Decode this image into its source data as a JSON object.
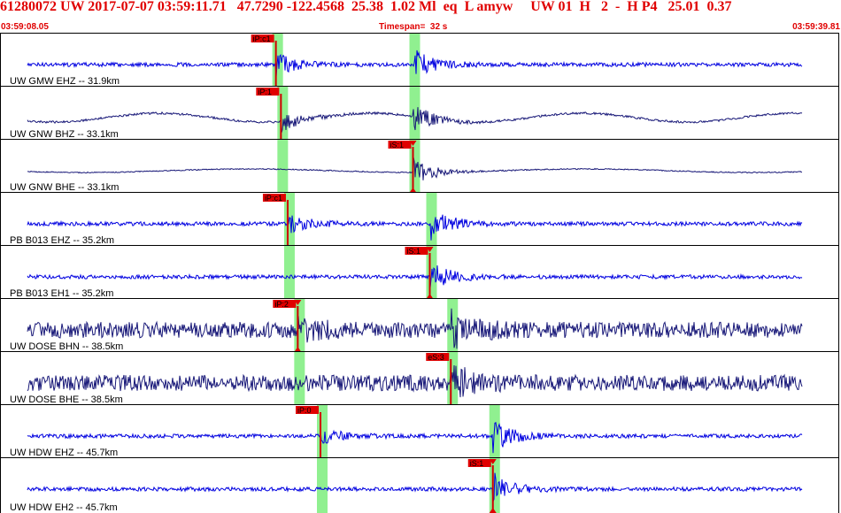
{
  "header": {
    "title": "61280072 UW 2017-07-07 03:59:11.71   47.7290 -122.4568  25.38  1.02 Ml  eq  L amyw     UW 01  H   2  -  H P4   25.01  0.37",
    "start_time": "03:59:08.05",
    "timespan": "Timespan=  32 s",
    "end_time": "03:59:39.81"
  },
  "colors": {
    "header_text": "#e00000",
    "trace_blue": "#0000e0",
    "trace_navy": "#181878",
    "pick_window": "#90f090",
    "pick_flag": "#e00000",
    "pick_line": "#d00000"
  },
  "channels": [
    {
      "label": "UW GMW EHZ -- 31.9km",
      "color": "blue",
      "style": "noisy",
      "picks": [
        {
          "name": "iP:c1",
          "t": 0.327,
          "marker": "left"
        }
      ],
      "windows": [
        0.327,
        0.49
      ],
      "bursts": [
        0.327,
        0.49
      ]
    },
    {
      "label": "UW GNW BHZ -- 33.1km",
      "color": "navy",
      "style": "wavy",
      "picks": [
        {
          "name": "iP:1",
          "t": 0.333,
          "marker": "left"
        }
      ],
      "windows": [
        0.333,
        0.49
      ],
      "bursts": [
        0.333,
        0.49
      ]
    },
    {
      "label": "UW GNW BHE -- 33.1km",
      "color": "navy",
      "style": "quiet",
      "picks": [
        {
          "name": "iS:1",
          "t": 0.49,
          "marker": "both"
        }
      ],
      "windows": [
        0.333,
        0.49
      ],
      "bursts": [
        0.49
      ]
    },
    {
      "label": "PB B013 EHZ -- 35.2km",
      "color": "blue",
      "style": "noisy",
      "picks": [
        {
          "name": "iP:c1",
          "t": 0.341,
          "marker": "left"
        }
      ],
      "windows": [
        0.341,
        0.51
      ],
      "bursts": [
        0.341,
        0.51
      ]
    },
    {
      "label": "PB B013 EH1 -- 35.2km",
      "color": "blue",
      "style": "noisy",
      "picks": [
        {
          "name": "iS:1",
          "t": 0.51,
          "marker": "both"
        }
      ],
      "windows": [
        0.341,
        0.51
      ],
      "bursts": [
        0.51
      ]
    },
    {
      "label": "UW DOSE BHN -- 38.5km",
      "color": "navy",
      "style": "busy",
      "picks": [
        {
          "name": "iP:2",
          "t": 0.353,
          "marker": "both"
        }
      ],
      "windows": [
        0.353,
        0.535
      ],
      "bursts": [
        0.353,
        0.535
      ]
    },
    {
      "label": "UW DOSE BHE -- 38.5km",
      "color": "navy",
      "style": "busy",
      "picks": [
        {
          "name": "eS:3",
          "t": 0.535,
          "marker": "left"
        }
      ],
      "windows": [
        0.353,
        0.535
      ],
      "bursts": [
        0.535
      ]
    },
    {
      "label": "UW HDW EHZ -- 45.7km",
      "color": "blue",
      "style": "noisy",
      "picks": [
        {
          "name": "iP:0",
          "t": 0.38,
          "marker": "left"
        }
      ],
      "windows": [
        0.38,
        0.585
      ],
      "bursts": [
        0.38,
        0.585
      ]
    },
    {
      "label": "UW HDW EH2 -- 45.7km",
      "color": "blue",
      "style": "noisy",
      "picks": [
        {
          "name": "iS:1",
          "t": 0.585,
          "marker": "both"
        }
      ],
      "windows": [
        0.38,
        0.585
      ],
      "bursts": [
        0.585
      ]
    }
  ]
}
